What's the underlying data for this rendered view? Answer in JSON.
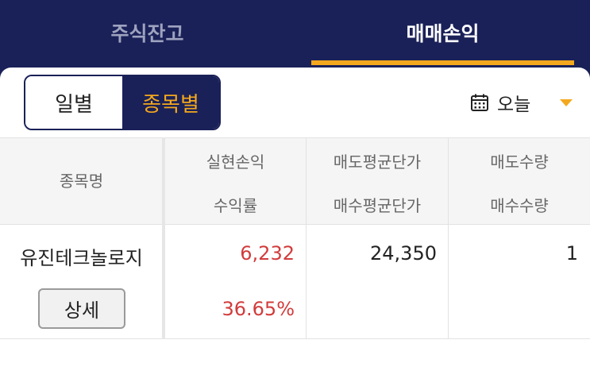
{
  "tabs": [
    {
      "label": "주식잔고"
    },
    {
      "label": "매매손익"
    }
  ],
  "segment": {
    "daily_label": "일별",
    "by_stock_label": "종목별"
  },
  "date_filter": {
    "label": "오늘",
    "icon": "calendar-icon"
  },
  "table": {
    "headers": {
      "name": "종목명",
      "realized_pl": "실현손익",
      "return_rate": "수익률",
      "sell_avg_price": "매도평균단가",
      "buy_avg_price": "매수평균단가",
      "sell_qty": "매도수량",
      "buy_qty": "매수수량"
    },
    "rows": [
      {
        "name": "유진테크놀로지",
        "realized_pl": "6,232",
        "return_rate": "36.65%",
        "sell_avg_price": "24,350",
        "buy_avg_price": "",
        "sell_qty": "1",
        "buy_qty": "",
        "detail_label": "상세"
      }
    ]
  },
  "colors": {
    "navy": "#1a2158",
    "accent": "#f4a81d",
    "profit": "#d23c3c"
  }
}
